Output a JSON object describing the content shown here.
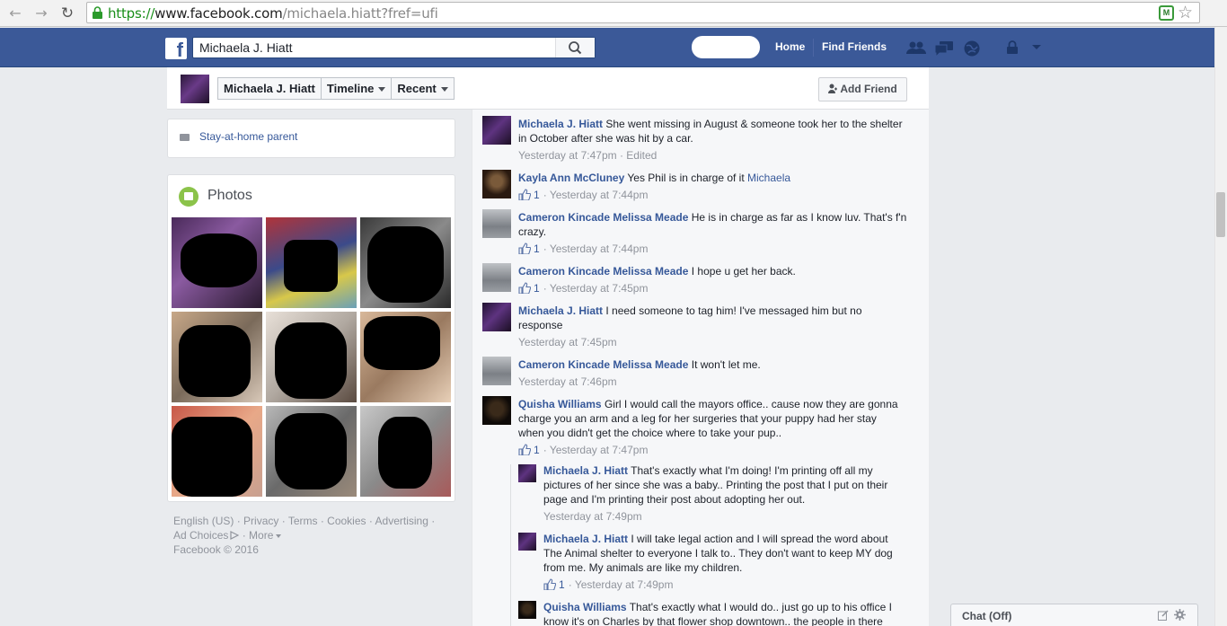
{
  "browser": {
    "url_scheme": "https://",
    "url_host": "www.facebook.com",
    "url_path": "/michaela.hiatt?fref=ufi"
  },
  "fbbar": {
    "logo": "f",
    "search_value": "Michaela J. Hiatt",
    "home": "Home",
    "find_friends": "Find Friends"
  },
  "timeline_header": {
    "name": "Michaela J. Hiatt",
    "timeline": "Timeline",
    "recent": "Recent",
    "add_friend": "Add Friend"
  },
  "intro": {
    "work": "Stay-at-home parent"
  },
  "photos": {
    "title": "Photos"
  },
  "footer": {
    "links": [
      "English (US)",
      "Privacy",
      "Terms",
      "Cookies",
      "Advertising",
      "Ad Choices",
      "More"
    ],
    "copyright": "Facebook © 2016"
  },
  "comments": [
    {
      "author": "Michaela J. Hiatt",
      "text": "She went missing in August & someone took her to the shelter in October after she was hit by a car.",
      "time": "Yesterday at 7:47pm · Edited"
    },
    {
      "author": "Kayla Ann McCluney",
      "text": "Yes Phil is in charge of it",
      "mention": "Michaela",
      "likes": "1",
      "time": "Yesterday at 7:44pm"
    },
    {
      "author": "Cameron Kincade Melissa Meade",
      "text": "He is in charge as far as I know luv. That's f'n crazy.",
      "likes": "1",
      "time": "Yesterday at 7:44pm"
    },
    {
      "author": "Cameron Kincade Melissa Meade",
      "text": "I hope u get her back.",
      "likes": "1",
      "time": "Yesterday at 7:45pm"
    },
    {
      "author": "Michaela J. Hiatt",
      "text": "I need someone to tag him! I've messaged him but no response",
      "time": "Yesterday at 7:45pm"
    },
    {
      "author": "Cameron Kincade Melissa Meade",
      "text": "It won't let me.",
      "time": "Yesterday at 7:46pm"
    },
    {
      "author": "Quisha Williams",
      "text": "Girl I would call the mayors office.. cause now they are gonna charge you an arm and a leg for her surgeries that your puppy had her stay when you didn't get the choice where to take your pup..",
      "likes": "1",
      "time": "Yesterday at 7:47pm"
    }
  ],
  "replies": [
    {
      "author": "Michaela J. Hiatt",
      "text": "That's exactly what I'm doing! I'm printing off all my pictures of her since she was a baby.. Printing the post that I put on their page and I'm printing their post about adopting her out.",
      "time": "Yesterday at 7:49pm"
    },
    {
      "author": "Michaela J. Hiatt",
      "text": "I will take legal action and I will spread the word about The Animal shelter to everyone I talk to.. They don't want to keep MY dog from me. My animals are like my children.",
      "likes": "1",
      "time": "Yesterday at 7:49pm"
    },
    {
      "author": "Quisha Williams",
      "text": "That's exactly what I would do.. just go up to his office I know it's on Charles by that flower shop downtown.. the people in there"
    }
  ],
  "chat": {
    "label": "Chat (Off)"
  }
}
